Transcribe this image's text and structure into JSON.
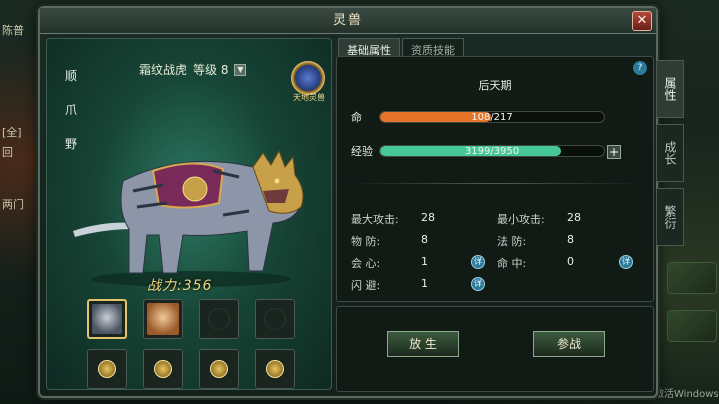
{
  "window": {
    "title": "灵兽",
    "close_icon": "✕"
  },
  "background": {
    "left_text": [
      "陈普",
      "[全]",
      "回",
      "两门"
    ],
    "bottom_text": "激活Windows"
  },
  "pet": {
    "name": "霜纹战虎",
    "level_label": "等级 8",
    "dropdown_icon": "▼",
    "seal_text": "天地灵兽",
    "power_label": "战力:356",
    "side_icons": [
      "顺",
      "爪",
      "野"
    ]
  },
  "tabs": [
    "基础属性",
    "资质技能"
  ],
  "stats": {
    "help_icon": "?",
    "stage": "后天期",
    "life": {
      "label": "命",
      "value": "108/217",
      "fraction": 0.497,
      "color": "#e8742a"
    },
    "exp": {
      "label": "经验",
      "value": "3199/3950",
      "fraction": 0.81,
      "color": "#46c79a",
      "plus": "+"
    },
    "items": [
      {
        "k": "最大攻击:",
        "v": "28"
      },
      {
        "k": "最小攻击:",
        "v": "28"
      },
      {
        "k": "物    防:",
        "v": "8"
      },
      {
        "k": "法    防:",
        "v": "8"
      },
      {
        "k": "会    心:",
        "v": "1"
      },
      {
        "k": "命    中:",
        "v": "0"
      },
      {
        "k": "闪    避:",
        "v": "1"
      }
    ],
    "detail_icon": "详"
  },
  "actions": {
    "release": "放 生",
    "battle": "参战"
  },
  "vtabs": [
    "属性",
    "成长",
    "繁衍"
  ],
  "colors": {
    "gold": "#e2c46b"
  }
}
